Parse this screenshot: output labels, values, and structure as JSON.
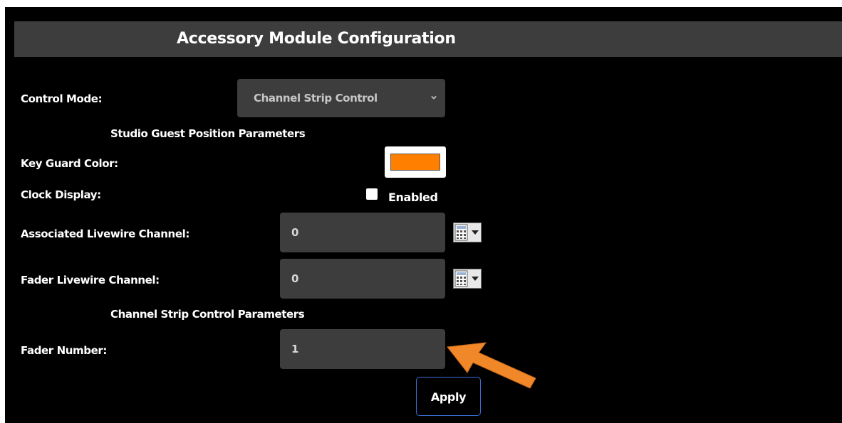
{
  "header": {
    "title": "Accessory Module Configuration"
  },
  "control_mode": {
    "label": "Control Mode:",
    "selected": "Channel Strip Control"
  },
  "sections": {
    "studio_guest": "Studio Guest Position Parameters",
    "channel_strip": "Channel Strip Control Parameters"
  },
  "key_guard_color": {
    "label": "Key Guard Color:",
    "value": "#ff7f00"
  },
  "clock_display": {
    "label": "Clock Display:",
    "checkbox_label": "Enabled",
    "checked": false
  },
  "associated_livewire_channel": {
    "label": "Associated Livewire Channel:",
    "value": "0"
  },
  "fader_livewire_channel": {
    "label": "Fader Livewire Channel:",
    "value": "0"
  },
  "fader_number": {
    "label": "Fader Number:",
    "value": "1"
  },
  "actions": {
    "apply_label": "Apply"
  },
  "icons": {
    "select_chevron": "chevron-down-icon",
    "channel_picker": "calculator-picker-icon",
    "annotation_arrow": "arrow-icon"
  },
  "colors": {
    "background": "#000000",
    "header_bar": "#3d3d3d",
    "field_bg": "#3d3d3d",
    "button_border": "#3a6fd8",
    "annotation": "#f0882a"
  }
}
